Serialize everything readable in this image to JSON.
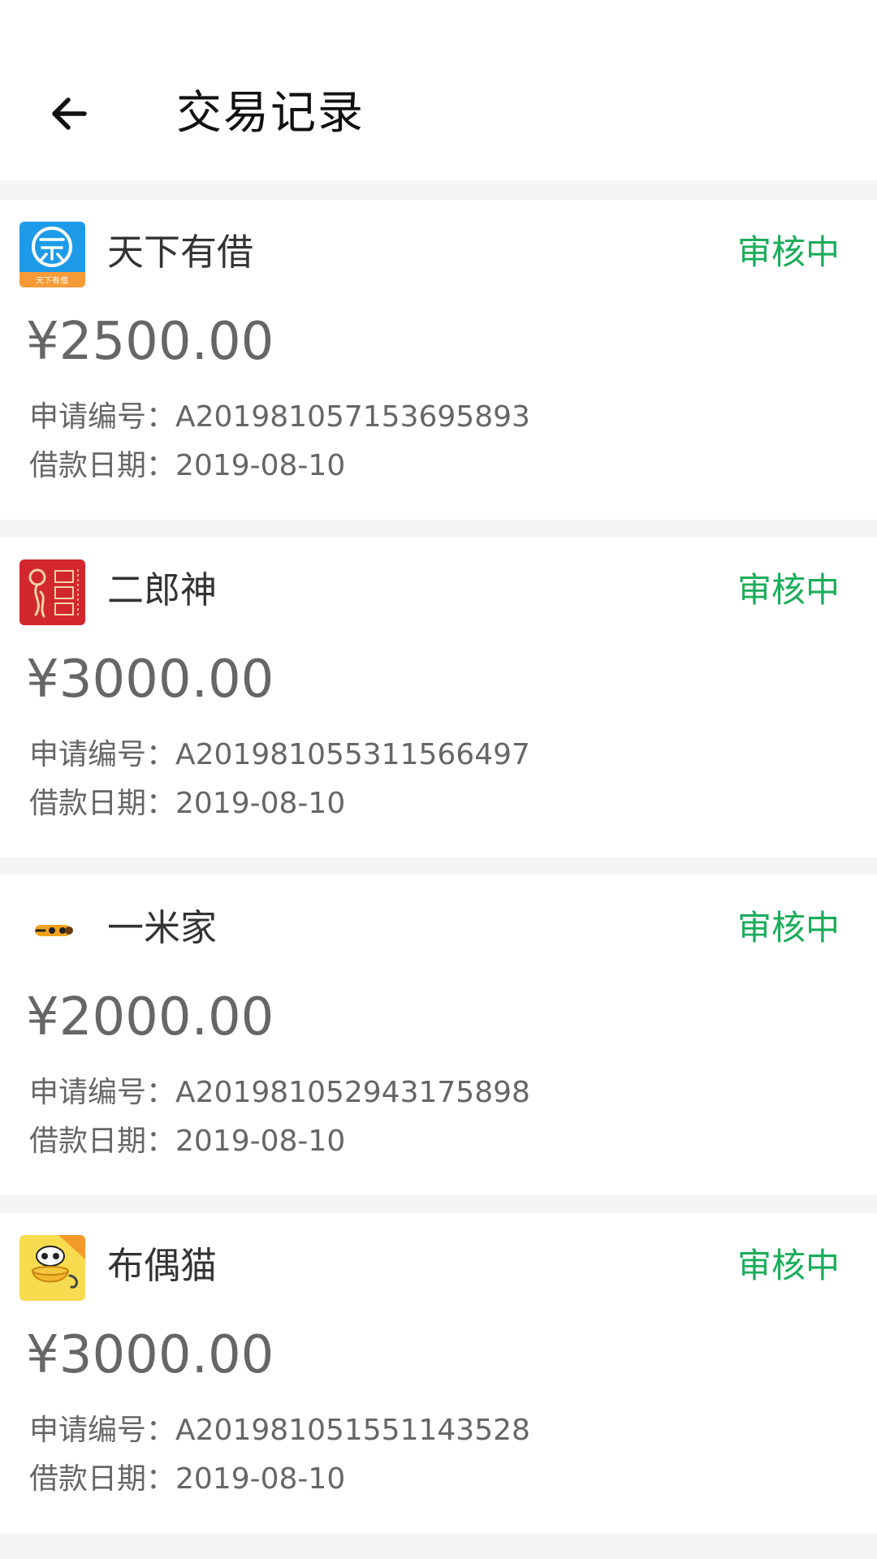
{
  "header": {
    "title": "交易记录",
    "back_icon": "arrow-left-icon"
  },
  "colors": {
    "status_green": "#1aad5a",
    "amount_gray": "#666666",
    "page_bg": "#f5f5f5"
  },
  "labels": {
    "application_no": "申请编号：",
    "loan_date": "借款日期："
  },
  "records": [
    {
      "name": "天下有借",
      "logo_icon": "tianxia-youjie-logo-icon",
      "logo_text": "天下有借",
      "status": "审核中",
      "amount": "¥2500.00",
      "application_no": "A201981057153695893",
      "loan_date": "2019-08-10"
    },
    {
      "name": "二郎神",
      "logo_icon": "erlangshen-logo-icon",
      "status": "审核中",
      "amount": "¥3000.00",
      "application_no": "A201981055311566497",
      "loan_date": "2019-08-10"
    },
    {
      "name": "一米家",
      "logo_icon": "yimijia-logo-icon",
      "status": "审核中",
      "amount": "¥2000.00",
      "application_no": "A201981052943175898",
      "loan_date": "2019-08-10"
    },
    {
      "name": "布偶猫",
      "logo_icon": "buoumao-logo-icon",
      "status": "审核中",
      "amount": "¥3000.00",
      "application_no": "A201981051551143528",
      "loan_date": "2019-08-10"
    }
  ]
}
